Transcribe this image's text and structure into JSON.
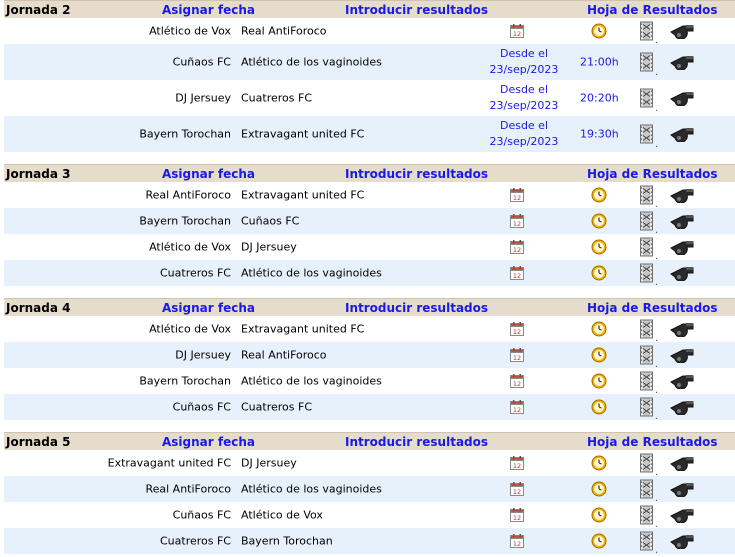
{
  "columns": {
    "assign": "Asignar fecha",
    "results": "Introducir resultados",
    "sheet": "Hoja de Resultados"
  },
  "icons": {
    "calendar": "calendar-icon",
    "clock": "clock-icon",
    "film": "film-reel-icon",
    "whistle": "whistle-icon"
  },
  "jornadas": [
    {
      "name": "Jornada 2",
      "matches": [
        {
          "home": "Atlético de Vox",
          "away": "Real AntiForoco",
          "date_prefix": "",
          "date": "",
          "time": ""
        },
        {
          "home": "Cuñaos FC",
          "away": "Atlético de los vaginoides",
          "date_prefix": "Desde el",
          "date": "23/sep/2023",
          "time": "21:00h"
        },
        {
          "home": "DJ Jersuey",
          "away": "Cuatreros FC",
          "date_prefix": "Desde el",
          "date": "23/sep/2023",
          "time": "20:20h"
        },
        {
          "home": "Bayern Torochan",
          "away": "Extravagant united FC",
          "date_prefix": "Desde el",
          "date": "23/sep/2023",
          "time": "19:30h"
        }
      ]
    },
    {
      "name": "Jornada 3",
      "matches": [
        {
          "home": "Real AntiForoco",
          "away": "Extravagant united FC"
        },
        {
          "home": "Bayern Torochan",
          "away": "Cuñaos FC"
        },
        {
          "home": "Atlético de Vox",
          "away": "DJ Jersuey"
        },
        {
          "home": "Cuatreros FC",
          "away": "Atlético de los vaginoides"
        }
      ]
    },
    {
      "name": "Jornada 4",
      "matches": [
        {
          "home": "Atlético de Vox",
          "away": "Extravagant united FC"
        },
        {
          "home": "DJ Jersuey",
          "away": "Real AntiForoco"
        },
        {
          "home": "Bayern Torochan",
          "away": "Atlético de los vaginoides"
        },
        {
          "home": "Cuñaos FC",
          "away": "Cuatreros FC"
        }
      ]
    },
    {
      "name": "Jornada 5",
      "matches": [
        {
          "home": "Extravagant united FC",
          "away": "DJ Jersuey"
        },
        {
          "home": "Real AntiForoco",
          "away": "Atlético de los vaginoides"
        },
        {
          "home": "Cuñaos FC",
          "away": "Atlético de Vox"
        },
        {
          "home": "Cuatreros FC",
          "away": "Bayern Torochan"
        }
      ]
    }
  ]
}
